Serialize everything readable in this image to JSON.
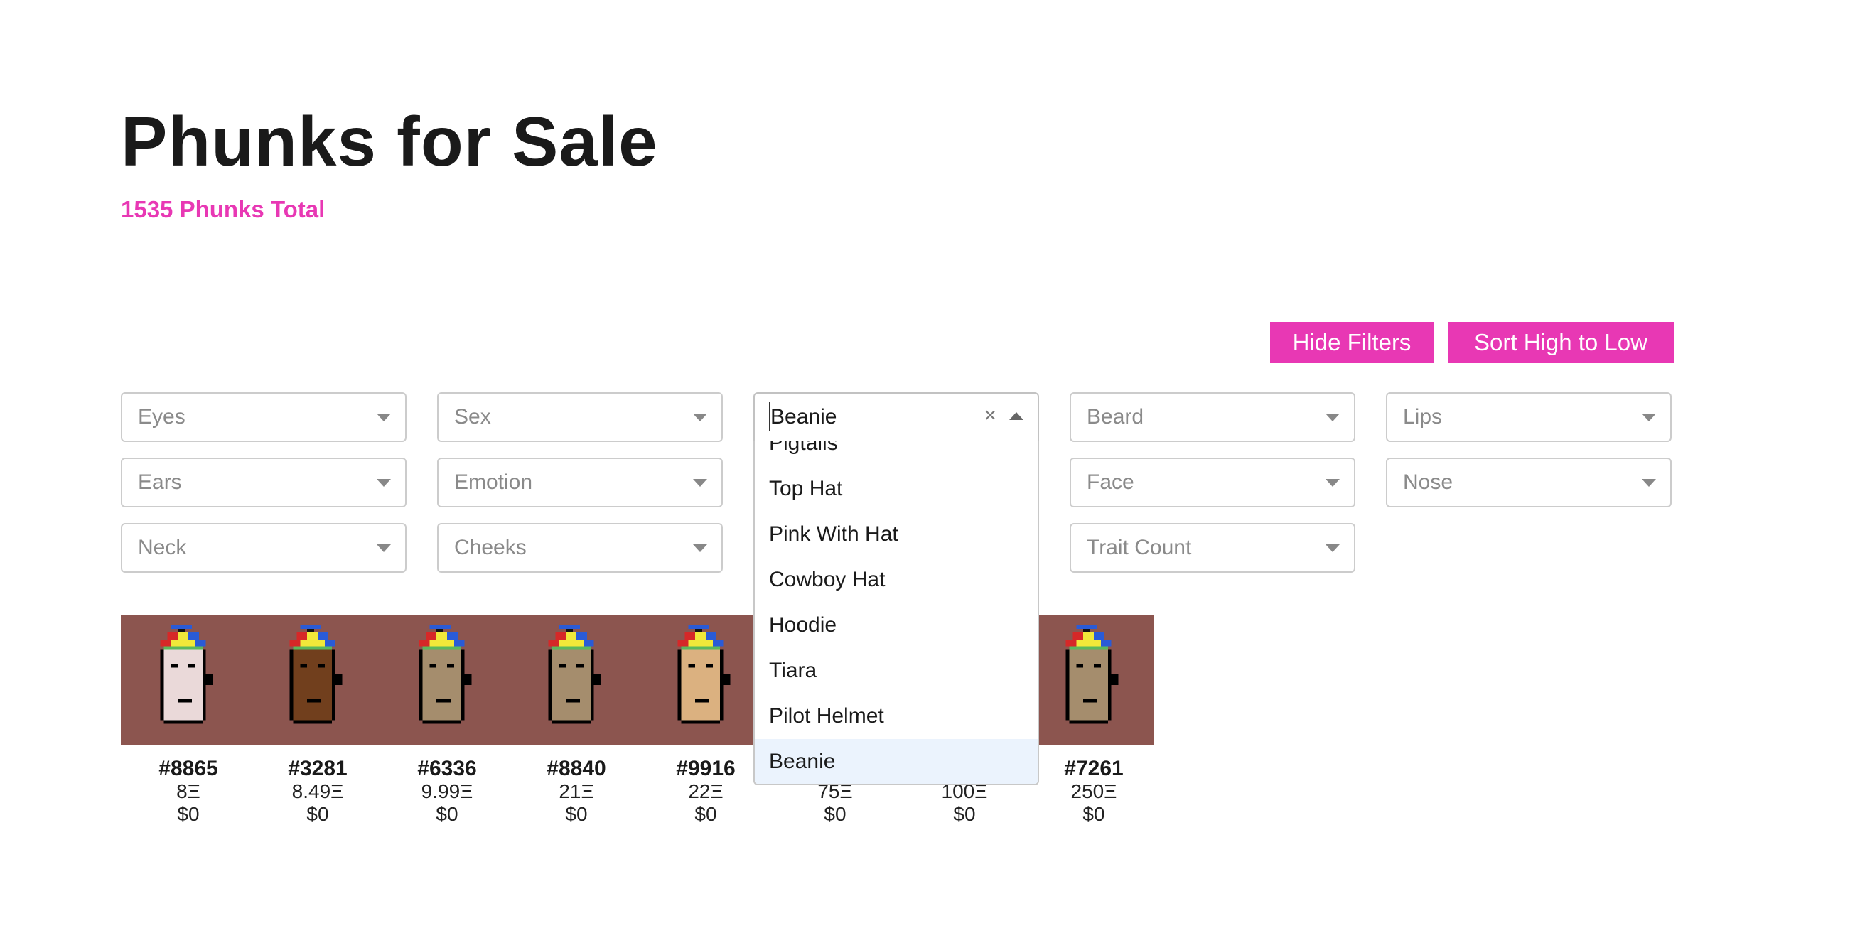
{
  "page": {
    "title": "Phunks for Sale",
    "subtitle": "1535 Phunks Total"
  },
  "toolbar": {
    "hide_filters": "Hide Filters",
    "sort": "Sort High to Low"
  },
  "colors": {
    "accent": "#e838b4",
    "strip_bg": "#8c554f"
  },
  "filters": {
    "eyes": "Eyes",
    "sex": "Sex",
    "hat_value": "Beanie",
    "beard": "Beard",
    "lips": "Lips",
    "ears": "Ears",
    "emotion": "Emotion",
    "face": "Face",
    "nose": "Nose",
    "neck": "Neck",
    "cheeks": "Cheeks",
    "trait_count": "Trait Count"
  },
  "hat_dropdown": {
    "options": [
      "Pigtails",
      "Top Hat",
      "Pink With Hat",
      "Cowboy Hat",
      "Hoodie",
      "Tiara",
      "Pilot Helmet",
      "Beanie"
    ],
    "selected": "Beanie"
  },
  "phunks": [
    {
      "id": "#8865",
      "price": "8Ξ",
      "usd": "$0"
    },
    {
      "id": "#3281",
      "price": "8.49Ξ",
      "usd": "$0"
    },
    {
      "id": "#6336",
      "price": "9.99Ξ",
      "usd": "$0"
    },
    {
      "id": "#8840",
      "price": "21Ξ",
      "usd": "$0"
    },
    {
      "id": "#9916",
      "price": "22Ξ",
      "usd": "$0"
    },
    {
      "id": "",
      "price": "75Ξ",
      "usd": "$0"
    },
    {
      "id": "",
      "price": "100Ξ",
      "usd": "$0"
    },
    {
      "id": "#7261",
      "price": "250Ξ",
      "usd": "$0"
    }
  ]
}
